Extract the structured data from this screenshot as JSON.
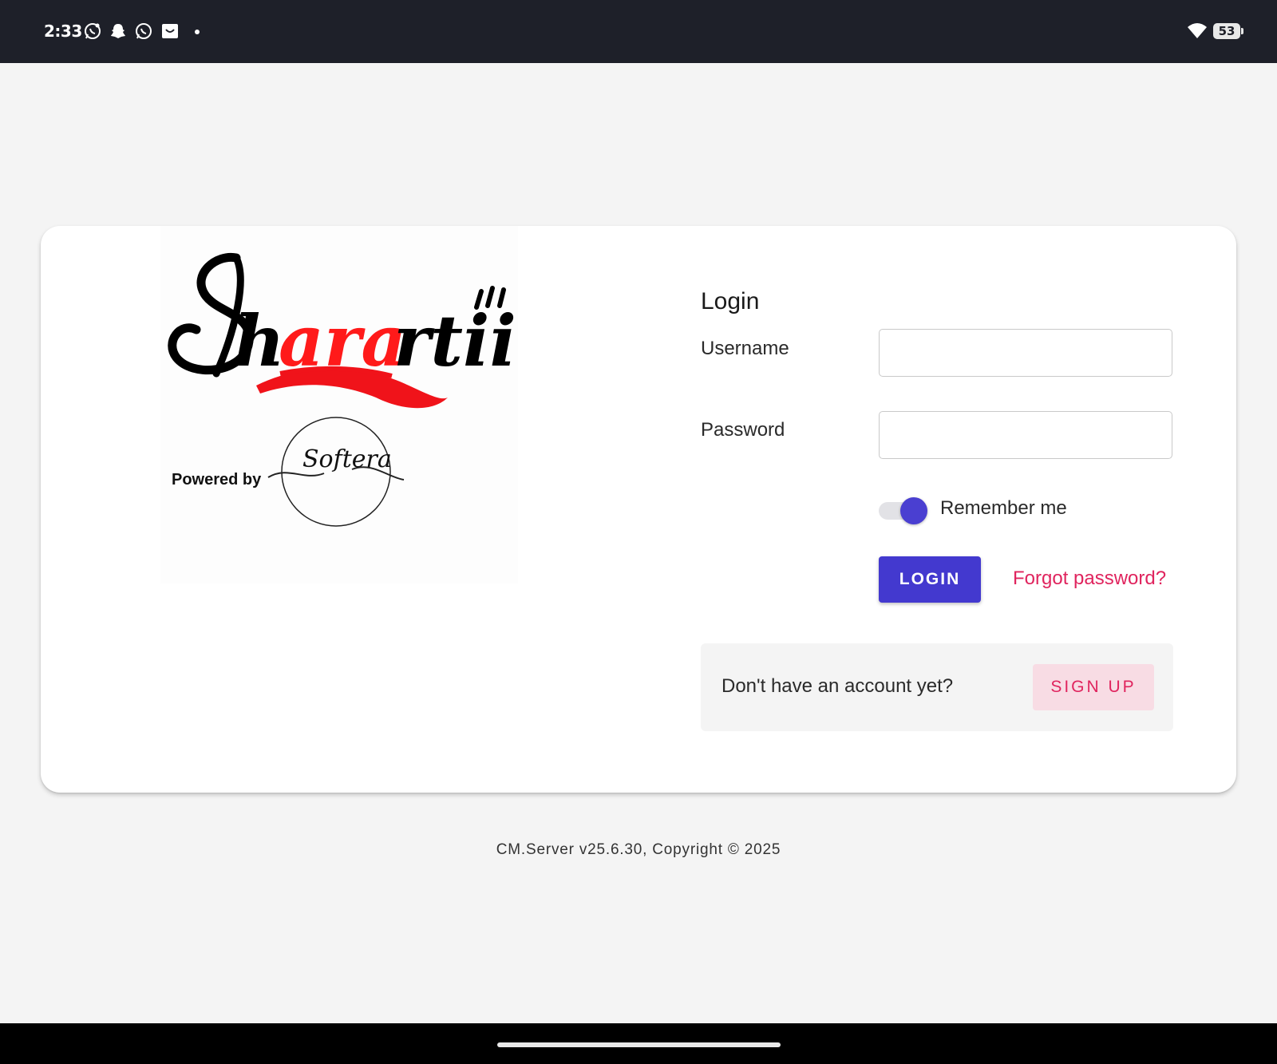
{
  "status_bar": {
    "time": "2:33",
    "notification_icons": [
      "whatsapp-business-icon",
      "snapchat-icon",
      "whatsapp-icon",
      "inbox-icon"
    ],
    "battery_level": "53",
    "wifi": "wifi-icon"
  },
  "logo": {
    "brand_name": "Sharartii",
    "powered_by": "Powered by",
    "partner_name": "Softera"
  },
  "login": {
    "title": "Login",
    "username_label": "Username",
    "username_value": "",
    "password_label": "Password",
    "password_value": "",
    "remember_label": "Remember me",
    "remember_checked": true,
    "login_button": "LOGIN",
    "forgot_link": "Forgot password?",
    "signup_prompt": "Don't have an account yet?",
    "signup_button": "SIGN UP"
  },
  "footer": {
    "text": "CM.Server v25.6.30, Copyright © 2025"
  },
  "colors": {
    "primary": "#4339cf",
    "accent": "#e0245e",
    "status_bar": "#1e2029",
    "background": "#f4f4f4"
  }
}
